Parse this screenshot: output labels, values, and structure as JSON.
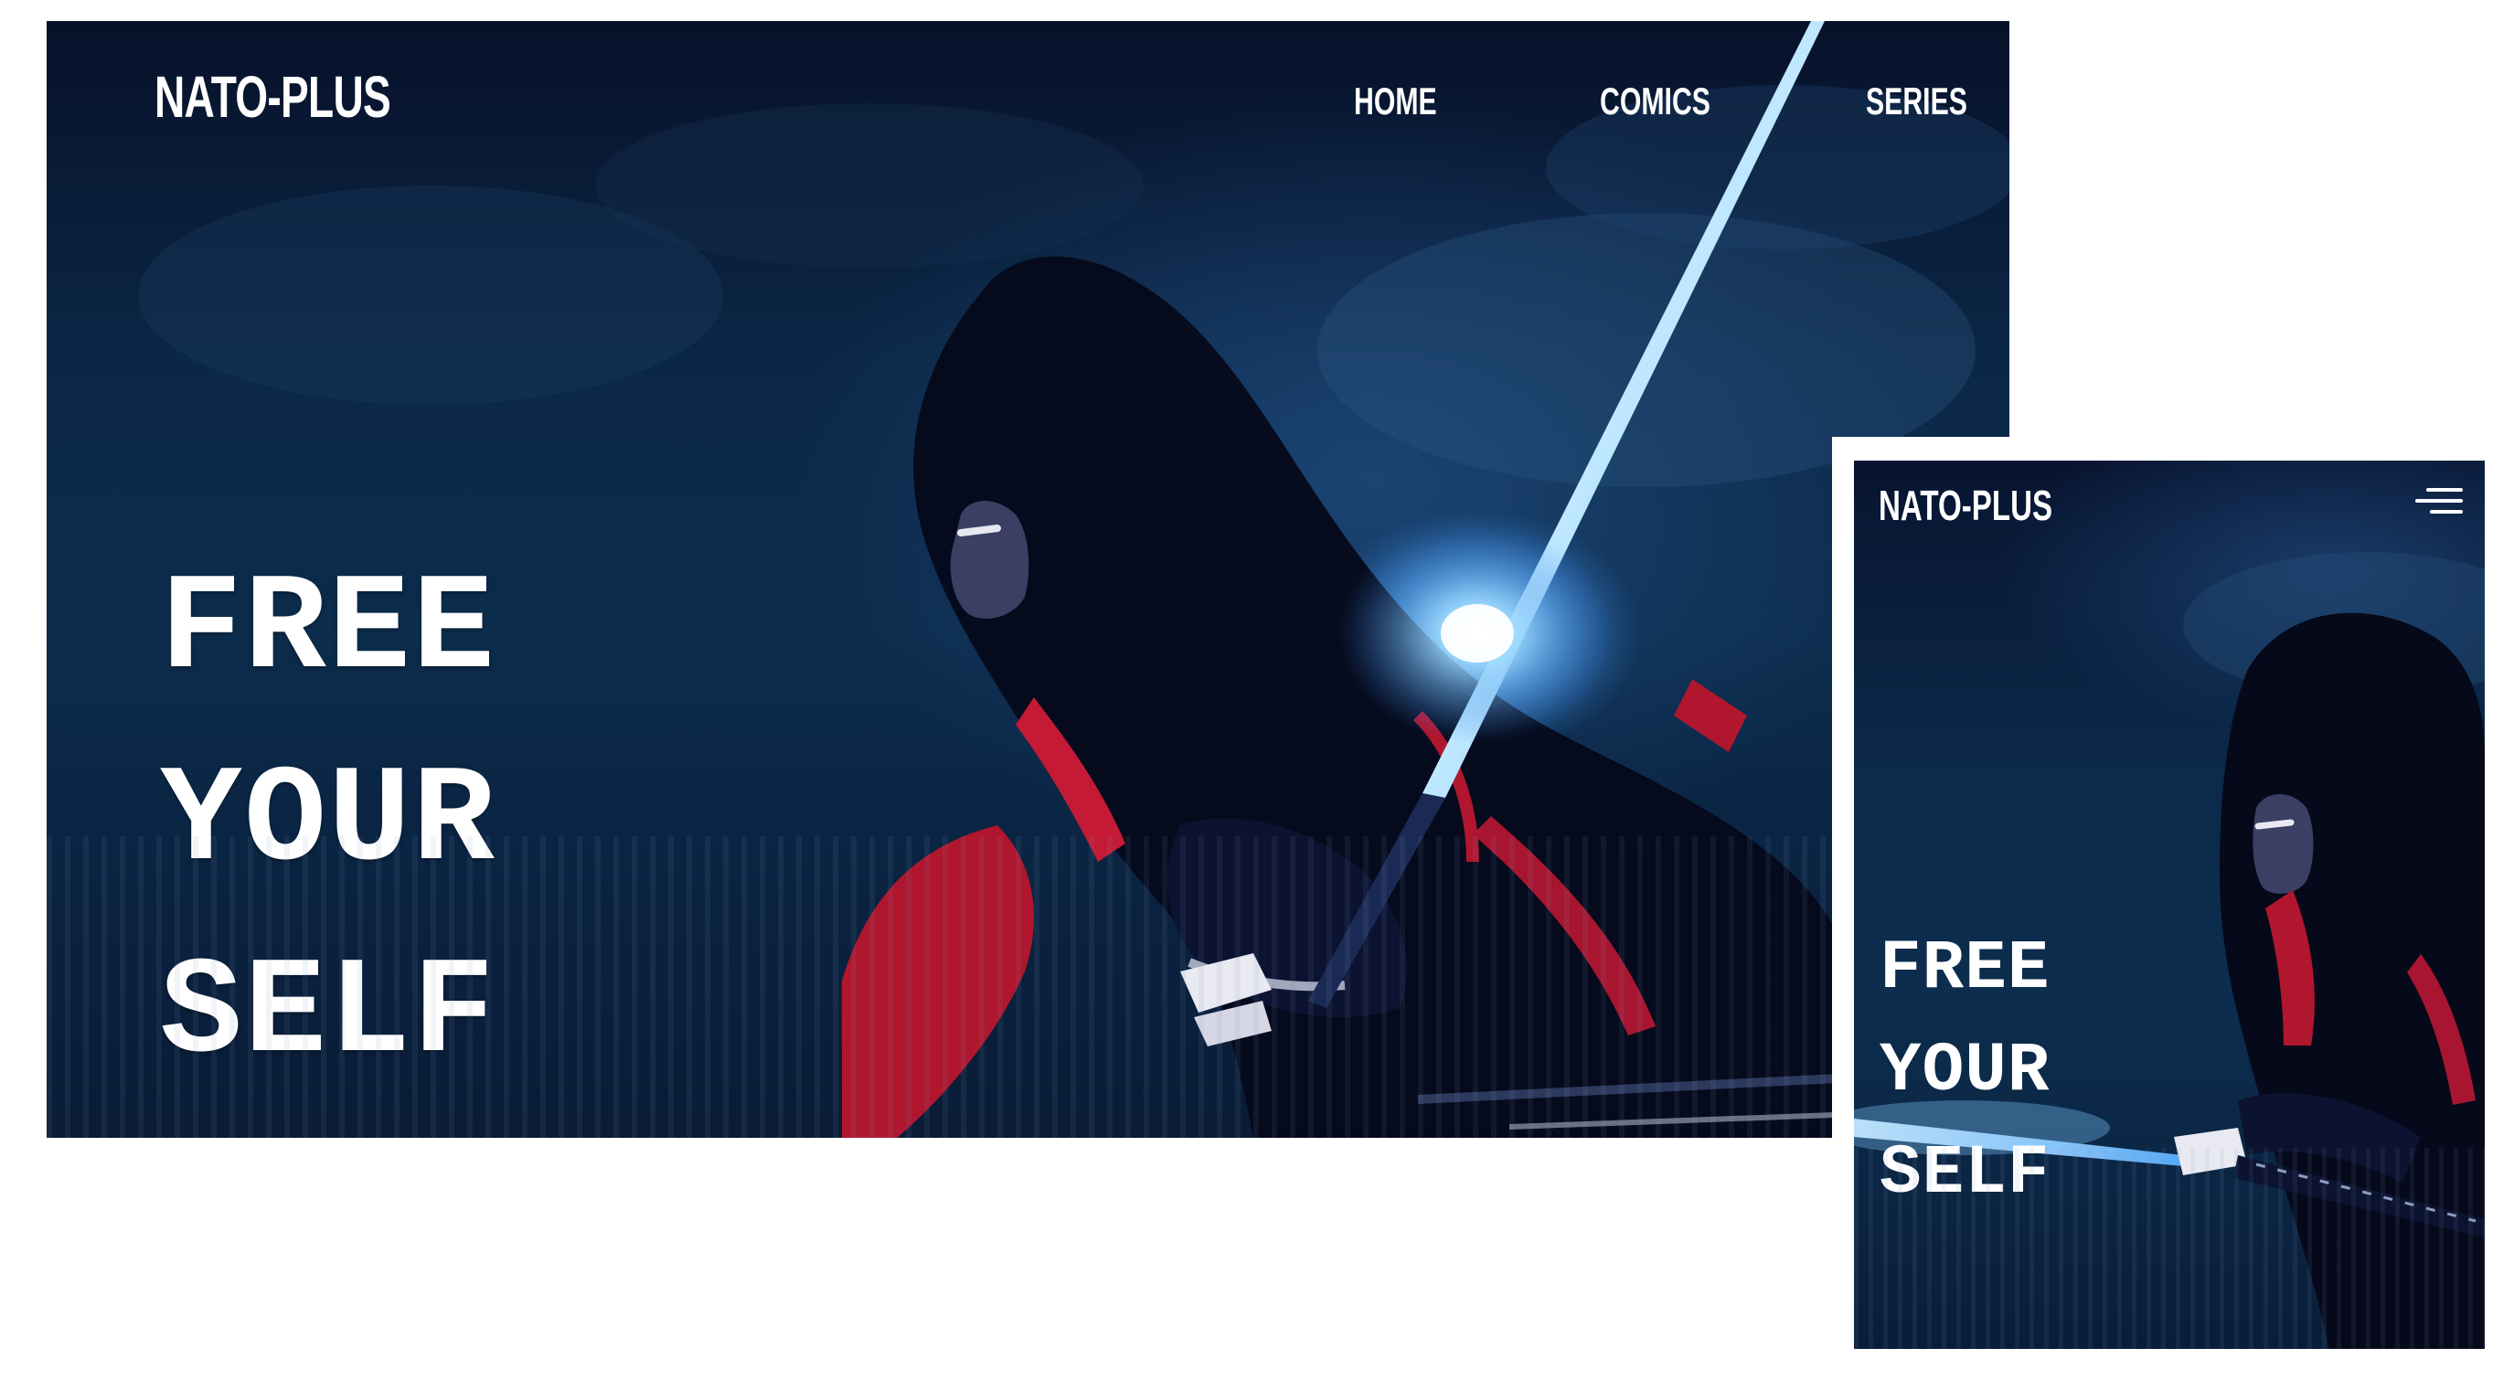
{
  "desktop": {
    "logo": "NATO-PLUS",
    "nav": [
      {
        "label": "HOME"
      },
      {
        "label": "COMICS"
      },
      {
        "label": "SERIES"
      }
    ],
    "hero_lines": [
      "FREE",
      "YOUR",
      "SELF"
    ]
  },
  "mobile": {
    "logo": "NATO-PLUS",
    "menu_icon": "hamburger-menu-icon",
    "hero_lines": [
      "FREE",
      "YOUR",
      "SELF"
    ]
  },
  "colors": {
    "background": "#0c2a4a",
    "text": "#ffffff",
    "sword_glow": "#7fc8ff",
    "cloak_accent": "#b0162e"
  }
}
